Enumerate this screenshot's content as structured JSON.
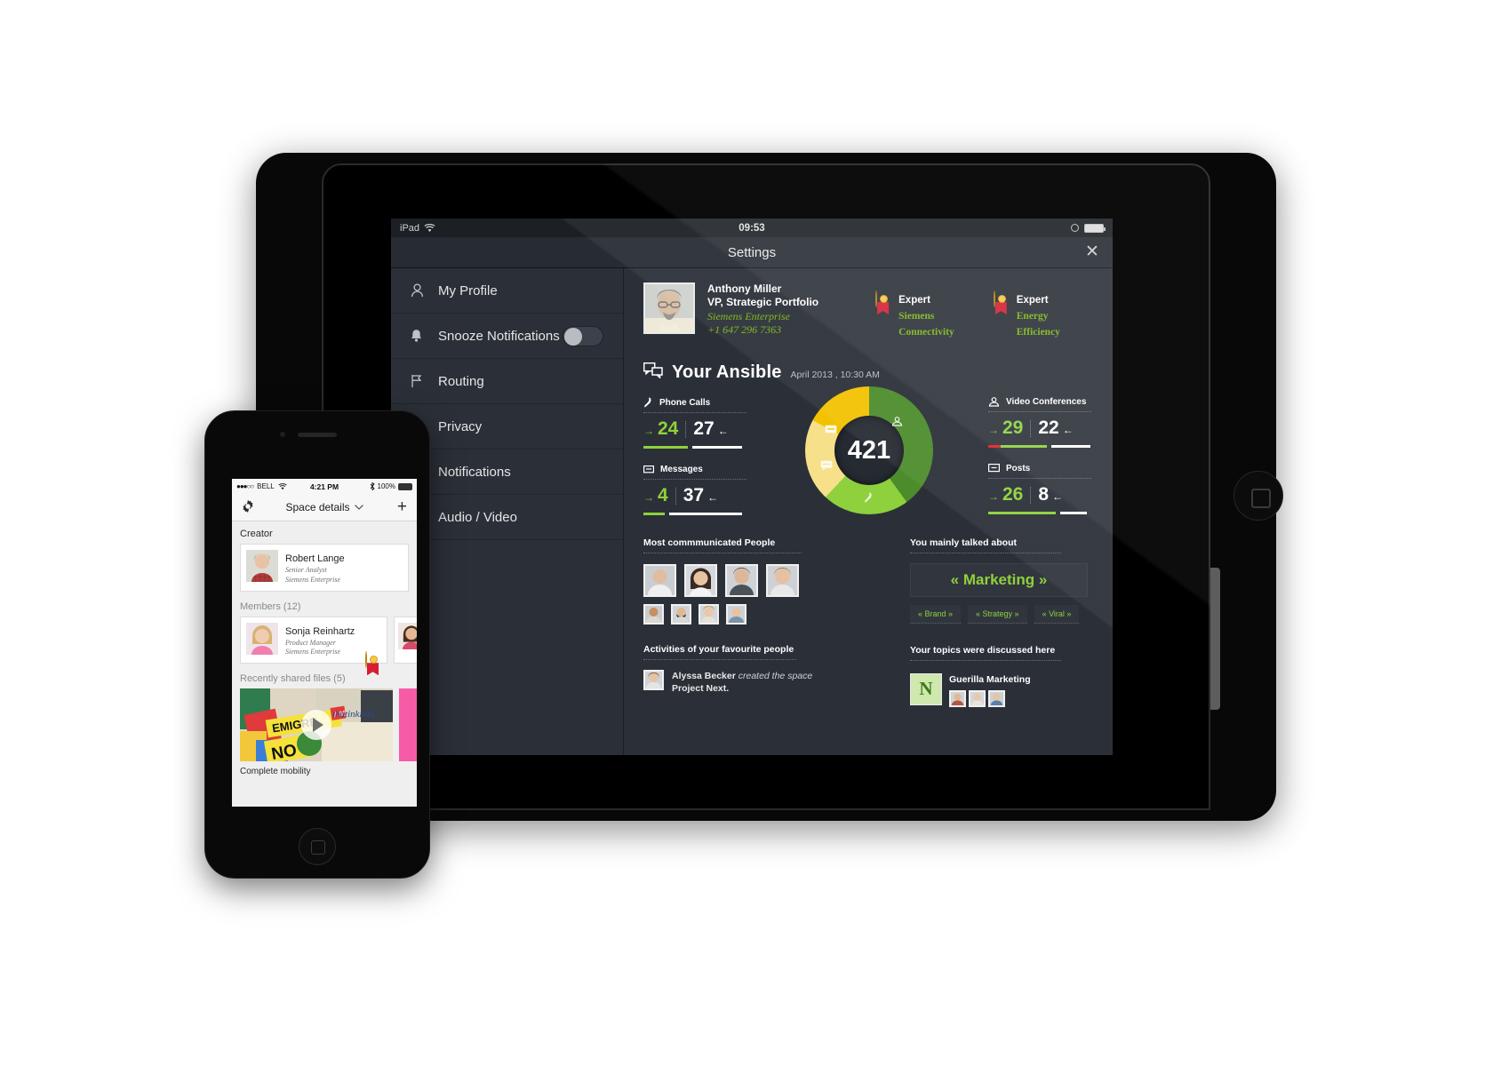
{
  "tablet": {
    "status_bar": {
      "device": "iPad",
      "wifi_icon": "wifi-icon",
      "time": "09:53",
      "lock_icon": "rotation-lock-icon",
      "battery_icon": "battery-icon"
    },
    "title_bar": {
      "title": "Settings",
      "close_icon": "close-icon"
    },
    "sidebar": {
      "items": [
        {
          "label": "My Profile",
          "icon": "person-icon"
        },
        {
          "label": "Snooze Notifications",
          "icon": "bell-icon",
          "toggle": "off"
        },
        {
          "label": "Routing",
          "icon": "routing-icon"
        },
        {
          "label": "Privacy",
          "icon": ""
        },
        {
          "label": "Notifications",
          "icon": ""
        },
        {
          "label": "Audio / Video",
          "icon": ""
        }
      ]
    },
    "profile": {
      "avatar": "user-avatar",
      "name": "Anthony Miller",
      "role": "VP, Strategic Portfolio",
      "company": "Siemens Enterprise",
      "phone": "+1 647 296 7363",
      "badges": [
        {
          "level": "Expert",
          "topic": "Siemens Connectivity",
          "icon": "medal-icon"
        },
        {
          "level": "Expert",
          "topic": "Energy Efficiency",
          "icon": "medal-icon"
        }
      ]
    },
    "ansible": {
      "icon": "chat-bubbles-icon",
      "title": "Your Ansible",
      "date": "April 2013 , 10:30 AM"
    },
    "stats": {
      "left": [
        {
          "label": "Phone Calls",
          "icon": "phone-icon",
          "out": "24",
          "in": "27",
          "out_arrow": "→",
          "in_arrow": "←"
        },
        {
          "label": "Messages",
          "icon": "message-icon",
          "out": "4",
          "in": "37",
          "out_arrow": "→",
          "in_arrow": "←"
        }
      ],
      "right": [
        {
          "label": "Video Conferences",
          "icon": "group-icon",
          "out": "29",
          "in": "22",
          "out_arrow": "→",
          "in_arrow": "←"
        },
        {
          "label": "Posts",
          "icon": "post-icon",
          "out": "26",
          "in": "8",
          "out_arrow": "→",
          "in_arrow": "←"
        }
      ]
    },
    "sections": {
      "most_communicated": "Most commmunicated People",
      "talked_about": "You mainly talked about",
      "activities": "Activities of your favourite people",
      "topics_discussed": "Your topics were discussed here"
    },
    "topics": {
      "main": "« Marketing »",
      "tags": [
        "« Brand »",
        "« Strategy »",
        "« Viral »"
      ]
    },
    "activity": {
      "person": "Alyssa Becker",
      "action": "created the space",
      "target": "Project Next."
    },
    "group": {
      "initial": "N",
      "name": "Guerilla Marketing"
    },
    "colors": {
      "accent_green": "#8ed13c",
      "deep_green": "#4c8c2b",
      "yellow": "#f2c200",
      "pale_yellow": "#f7e08a",
      "panel": "#2b3038",
      "screen_bg": "#262b33",
      "red": "#e02020"
    }
  },
  "donut": {
    "center_value": "421",
    "segments": [
      {
        "name": "video",
        "value": 40,
        "color": "#4c8c2b",
        "icon": "group-icon"
      },
      {
        "name": "phone",
        "value": 22,
        "color": "#8ed13c",
        "icon": "phone-icon"
      },
      {
        "name": "messages",
        "value": 21,
        "color": "#f7e08a",
        "icon": "chat-icon"
      },
      {
        "name": "posts",
        "value": 17,
        "color": "#f2c200",
        "icon": "post-icon"
      }
    ]
  },
  "chart_data": {
    "type": "pie",
    "title": "Your Ansible",
    "categories": [
      "Video Conferences",
      "Phone Calls",
      "Messages",
      "Posts"
    ],
    "values": [
      51,
      51,
      41,
      34
    ],
    "colors": [
      "#4c8c2b",
      "#8ed13c",
      "#f7e08a",
      "#f2c200"
    ],
    "total": 421,
    "legend": "inline-icons"
  },
  "phone": {
    "status_bar": {
      "signal": "●●●○○",
      "carrier": "BELL",
      "wifi_icon": "wifi-icon",
      "time": "4:21 PM",
      "bluetooth_icon": "bluetooth-icon",
      "battery": "100%"
    },
    "nav": {
      "gear_icon": "gear-icon",
      "title": "Space details",
      "chevron_icon": "chevron-down-icon",
      "add_icon": "plus-icon"
    },
    "creator": {
      "section": "Creator",
      "name": "Robert Lange",
      "role": "Senior Analyst",
      "company": "Siemens Enterprise"
    },
    "members": {
      "section": "Members",
      "count": "(12)",
      "name": "Sonja Reinhartz",
      "role": "Product Manager",
      "company": "Siemens Enterprise",
      "badge_icon": "medal-icon"
    },
    "files": {
      "section": "Recently shared files",
      "count": "(5)",
      "caption": "Complete mobility",
      "play_icon": "play-icon"
    }
  }
}
